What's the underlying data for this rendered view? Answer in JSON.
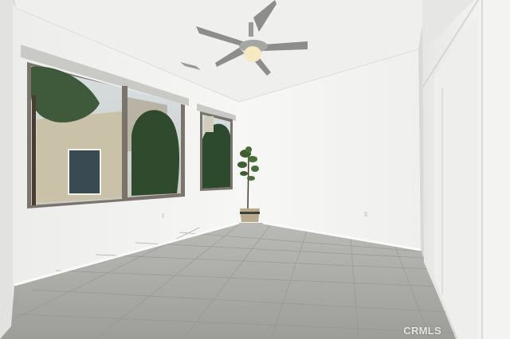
{
  "photo": {
    "subject": "empty-room-interior",
    "objects": [
      "ceiling-fan",
      "window-large",
      "window-small",
      "potted-plant",
      "closet-sliding-door",
      "tile-floor",
      "ceiling-vent"
    ]
  },
  "watermark": {
    "text": "CRMLS"
  },
  "colors": {
    "wall": "#f1f1ef",
    "wall_shadow": "#e4e4e2",
    "ceiling": "#eeeeec",
    "floor": "#a8a8a4",
    "window_frame": "#7a746d",
    "foliage": "#3f5a3a"
  }
}
